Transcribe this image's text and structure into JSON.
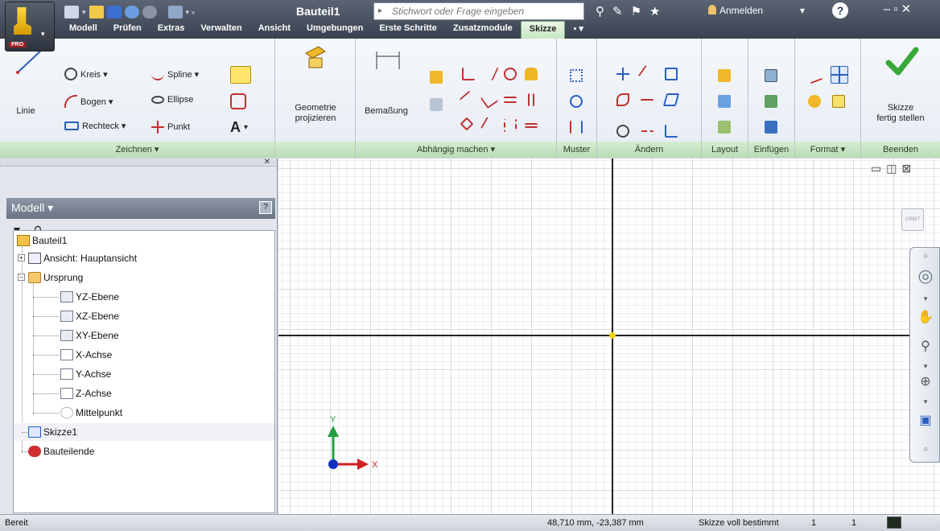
{
  "window": {
    "document_title": "Bauteil1",
    "search_placeholder": "Stichwort oder Frage eingeben",
    "signin_label": "Anmelden",
    "help_label": "?",
    "pro_badge": "PRO"
  },
  "tabs": [
    {
      "label": "Modell"
    },
    {
      "label": "Prüfen"
    },
    {
      "label": "Extras"
    },
    {
      "label": "Verwalten"
    },
    {
      "label": "Ansicht"
    },
    {
      "label": "Umgebungen"
    },
    {
      "label": "Erste Schritte"
    },
    {
      "label": "Zusatzmodule"
    },
    {
      "label": "Skizze",
      "active": true
    }
  ],
  "ribbon": {
    "draw": {
      "footer": "Zeichnen ▾",
      "line": "Linie",
      "circle": "Kreis ▾",
      "arc": "Bogen ▾",
      "rectangle": "Rechteck ▾",
      "spline": "Spline ▾",
      "ellipse": "Ellipse",
      "point": "Punkt",
      "text_glyph": "A"
    },
    "project": {
      "label_line1": "Geometrie",
      "label_line2": "projizieren"
    },
    "constrain": {
      "footer": "Abhängig machen ▾",
      "dimension": "Bemaßung"
    },
    "pattern": {
      "footer": "Muster"
    },
    "modify": {
      "footer": "Ändern"
    },
    "layout": {
      "footer": "Layout"
    },
    "insert": {
      "footer": "Einfügen"
    },
    "format": {
      "footer": "Format ▾"
    },
    "exit": {
      "footer": "Beenden",
      "finish_line1": "Skizze",
      "finish_line2": "fertig stellen"
    }
  },
  "browser": {
    "title": "Modell ▾",
    "help": "?",
    "tree": [
      {
        "label": "Bauteil1",
        "icon": "part-icon"
      },
      {
        "label": "Ansicht: Hauptansicht",
        "icon": "view-icon"
      },
      {
        "label": "Ursprung",
        "icon": "folder-icon"
      },
      {
        "label": "YZ-Ebene",
        "icon": "plane-icon"
      },
      {
        "label": "XZ-Ebene",
        "icon": "plane-icon"
      },
      {
        "label": "XY-Ebene",
        "icon": "plane-icon"
      },
      {
        "label": "X-Achse",
        "icon": "axis-icon"
      },
      {
        "label": "Y-Achse",
        "icon": "axis-icon"
      },
      {
        "label": "Z-Achse",
        "icon": "axis-icon"
      },
      {
        "label": "Mittelpunkt",
        "icon": "point-icon"
      },
      {
        "label": "Skizze1",
        "icon": "sketch-icon"
      },
      {
        "label": "Bauteilende",
        "icon": "end-of-part-icon"
      }
    ]
  },
  "canvas": {
    "triad_x": "X",
    "triad_y": "Y",
    "viewcube_label": "ORBIT"
  },
  "status": {
    "left": "Bereit",
    "coordinates": "48,710 mm, -23,387 mm",
    "constraint_state": "Skizze voll bestimmt",
    "count1": "1",
    "count2": "1"
  },
  "colors": {
    "active_tab": "#c7e6c3",
    "panel_footer": "#b9dcb5",
    "origin": "#f2d200",
    "triad_x": "#d02020",
    "triad_y": "#20a040",
    "triad_z": "#1030c0"
  }
}
